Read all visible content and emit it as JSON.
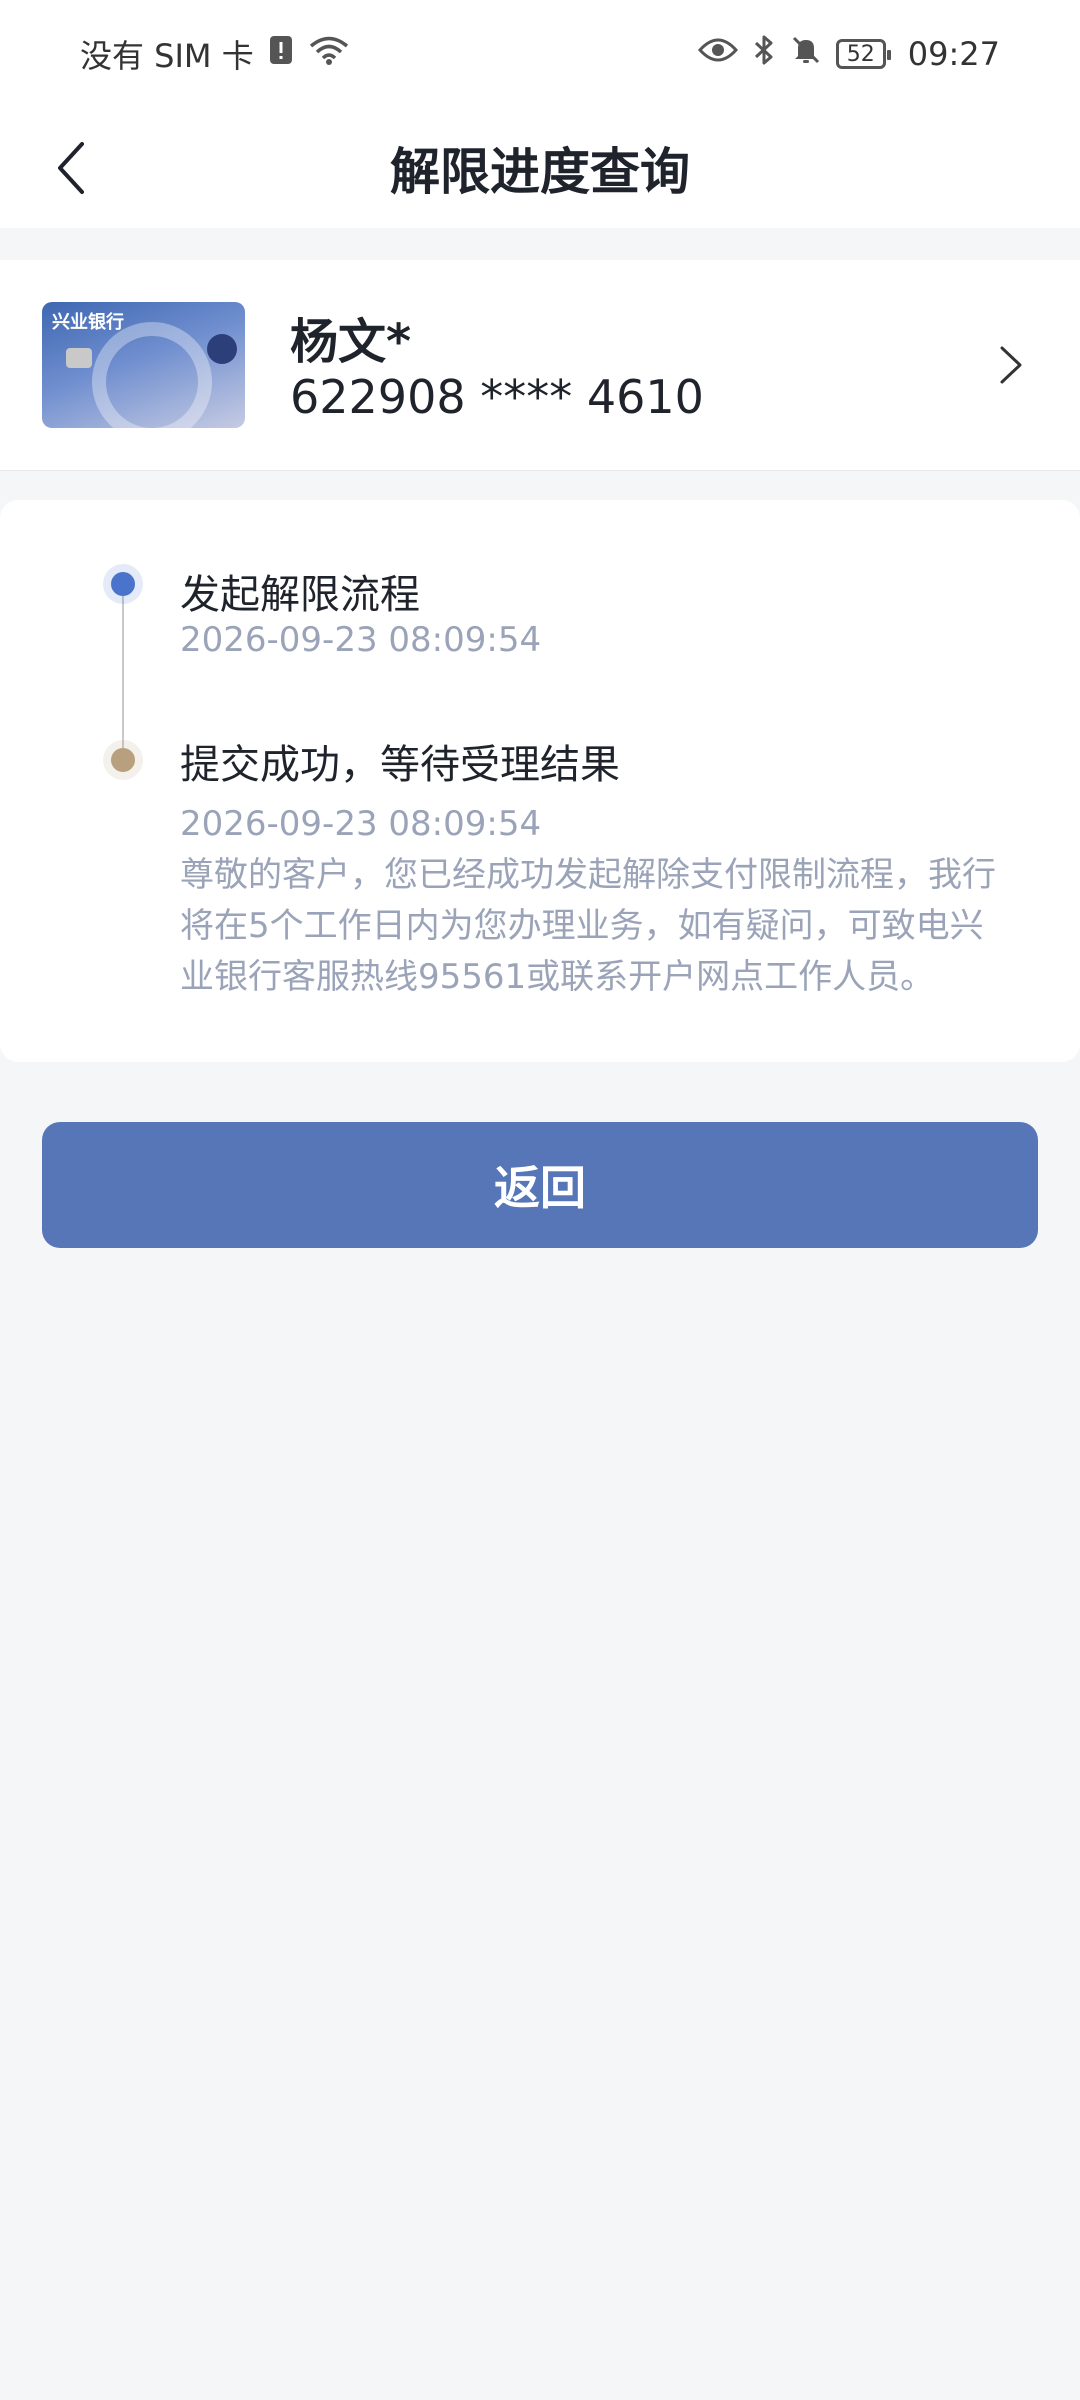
{
  "status_bar": {
    "sim": "没有 SIM 卡",
    "battery": "52",
    "time": "09:27"
  },
  "header": {
    "title": "解限进度查询"
  },
  "card": {
    "bank_logo": "兴业银行",
    "holder_name": "杨文*",
    "number": "622908 **** 4610"
  },
  "progress": {
    "steps": [
      {
        "title": "发起解限流程",
        "time": "2026-09-23 08:09:54"
      },
      {
        "title": "提交成功，等待受理结果",
        "time": "2026-09-23 08:09:54",
        "description": "尊敬的客户，您已经成功发起解除支付限制流程，我行将在5个工作日内为您办理业务，如有疑问，可致电兴业银行客服热线95561或联系开户网点工作人员。"
      }
    ]
  },
  "actions": {
    "return_label": "返回"
  },
  "colors": {
    "primary": "#5776b8",
    "step_active": "#4a74cc",
    "step_pending": "#b8a07e",
    "muted_text": "#9aa3b8"
  }
}
